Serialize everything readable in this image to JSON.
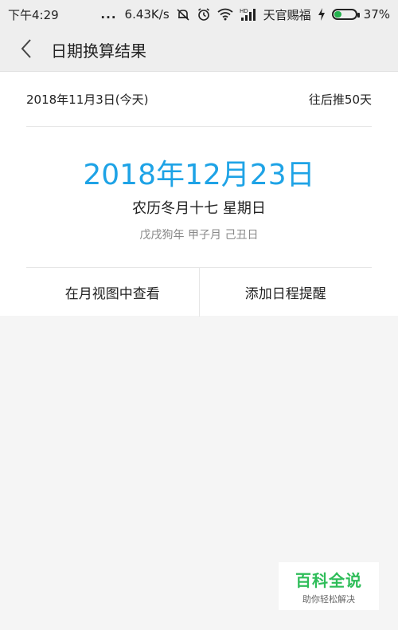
{
  "status_bar": {
    "time": "下午4:29",
    "dots": "...",
    "speed": "6.43K/s",
    "carrier": "天官赐福",
    "battery_text": "37%",
    "battery_level": 0.37,
    "icons": [
      "mute-icon",
      "alarm-icon",
      "wifi-icon",
      "hd-signal-icon",
      "charging-icon",
      "battery-icon"
    ]
  },
  "header": {
    "title": "日期换算结果",
    "back_icon": "chevron-left-icon"
  },
  "card": {
    "start_date": "2018年11月3日(今天)",
    "offset": "往后推50天",
    "result_date": "2018年12月23日",
    "lunar": "农历冬月十七 星期日",
    "ganzhi": "戊戌狗年 甲子月 己丑日",
    "accent_color": "#1ea3e6"
  },
  "actions": {
    "month_view": "在月视图中查看",
    "add_reminder": "添加日程提醒"
  },
  "watermark": {
    "title": "百科全说",
    "subtitle": "助你轻松解决",
    "color": "#2ebd59"
  }
}
